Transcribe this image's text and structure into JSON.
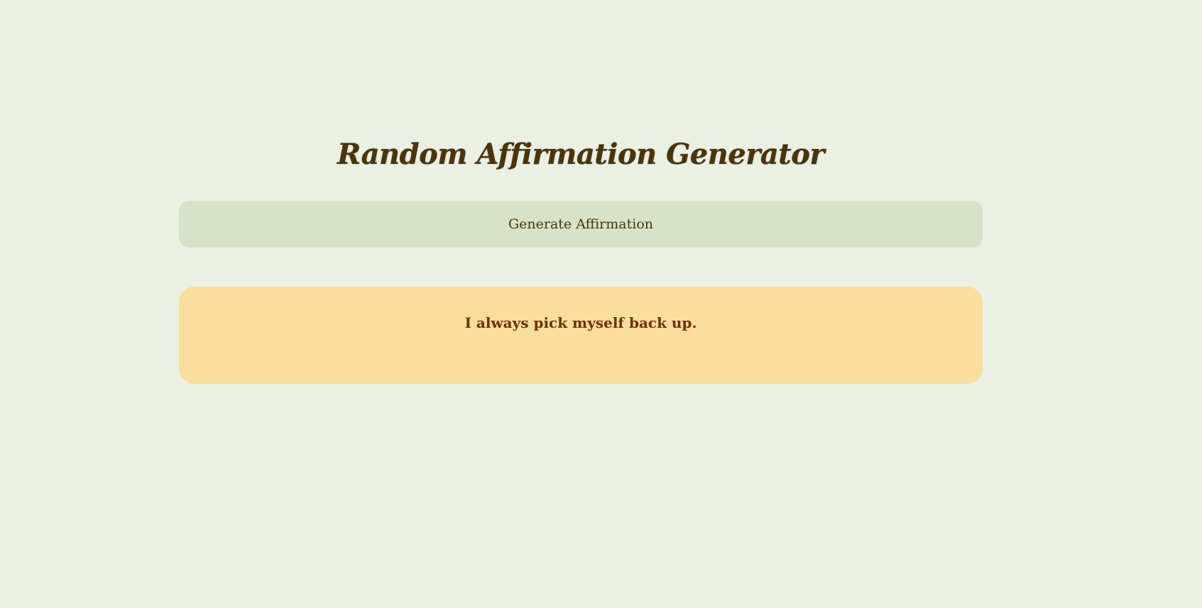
{
  "header": {
    "title": "Random Affirmation Generator"
  },
  "controls": {
    "generate_label": "Generate Affirmation"
  },
  "affirmation": {
    "text": "I always pick myself back up."
  },
  "colors": {
    "background": "#eaf0e4",
    "button_background": "#d6e3c8",
    "card_background": "#fbdd9c",
    "title_text": "#4a3409",
    "affirmation_text": "#6e2f0a"
  }
}
